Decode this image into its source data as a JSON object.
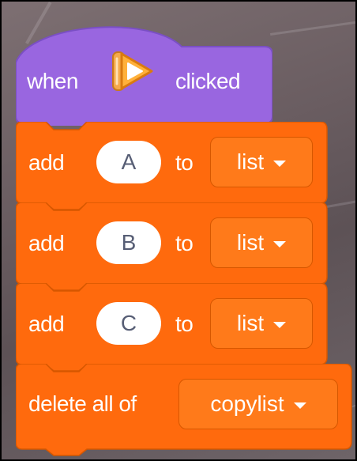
{
  "hat_block": {
    "prefix": "when",
    "icon": "green-flag-play-icon",
    "suffix": "clicked",
    "color": "#9966e0"
  },
  "stack_color": "#ff6a0d",
  "blocks": [
    {
      "verb": "add",
      "value": "A",
      "connector": "to",
      "list": "list"
    },
    {
      "verb": "add",
      "value": "B",
      "connector": "to",
      "list": "list"
    },
    {
      "verb": "add",
      "value": "C",
      "connector": "to",
      "list": "list"
    }
  ],
  "delete_block": {
    "label": "delete all of",
    "list": "copylist"
  }
}
